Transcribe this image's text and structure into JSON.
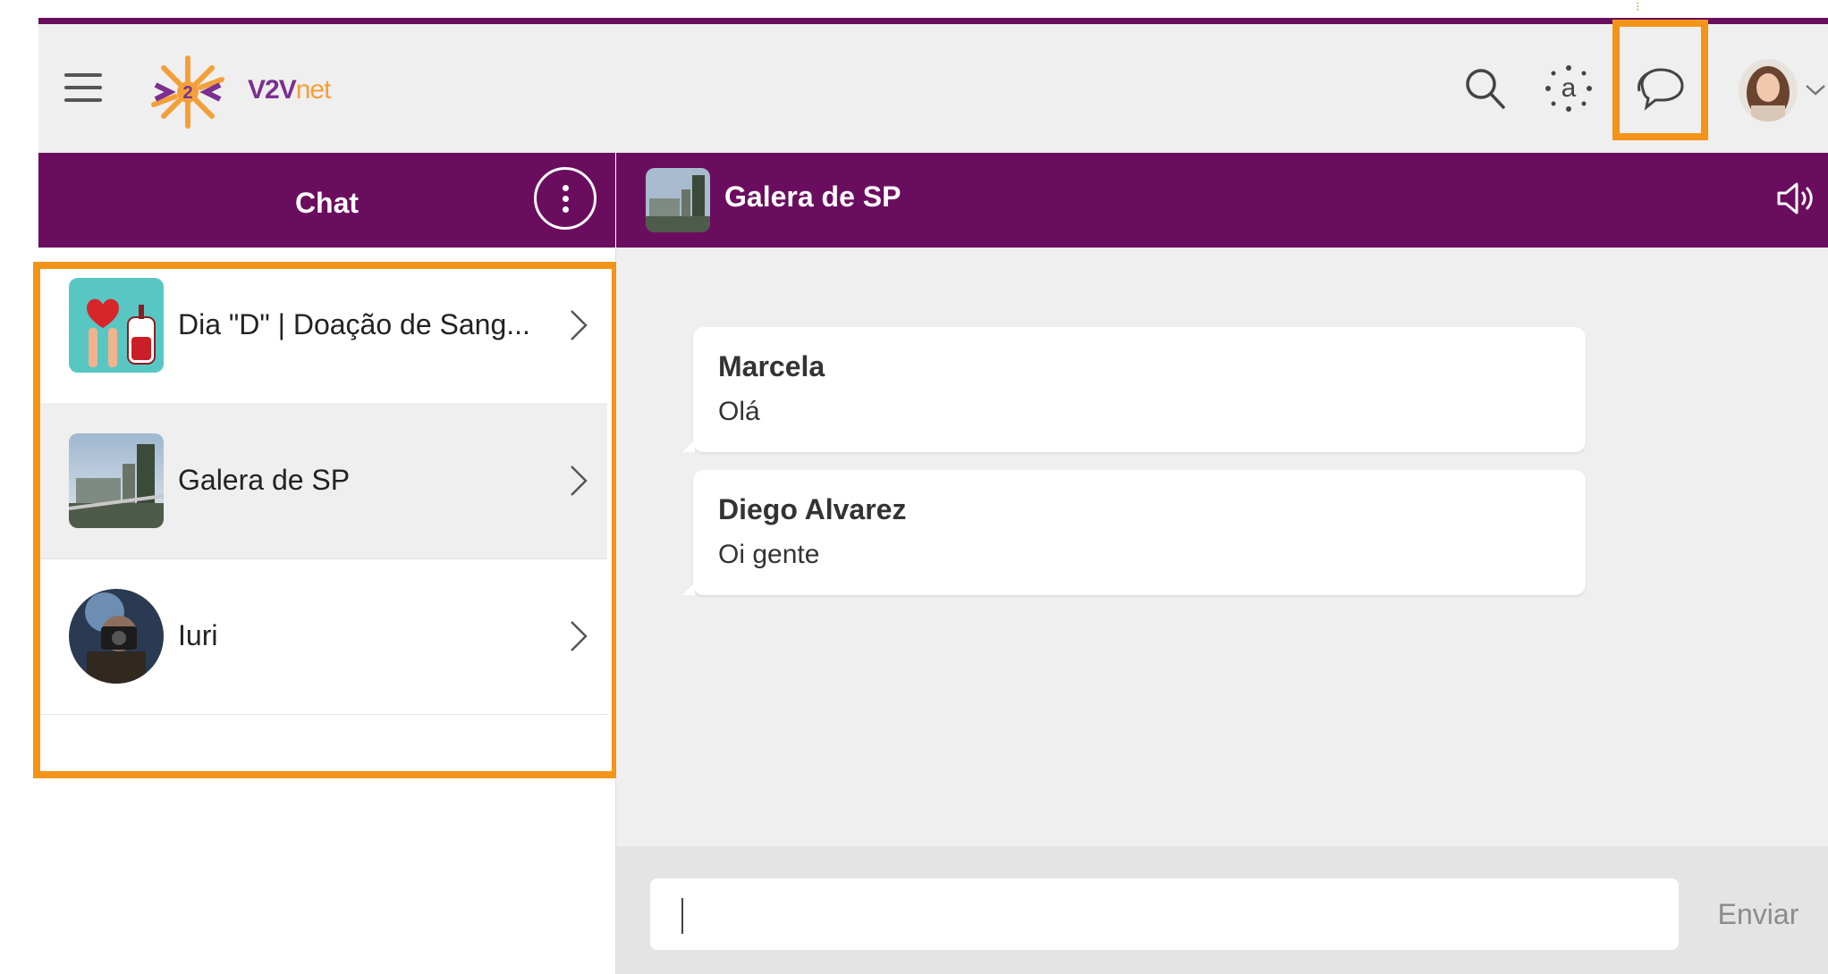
{
  "app": {
    "logo_text_main": "V2V",
    "logo_text_suffix": "net",
    "logo_mark": "2"
  },
  "header": {
    "icons": [
      "menu-icon",
      "search-icon",
      "accessibility-icon",
      "chat-icon",
      "profile-avatar",
      "chevron-down-icon"
    ]
  },
  "sidebar": {
    "title": "Chat",
    "more_icon": "more-vertical-icon",
    "conversations": [
      {
        "name": "Dia \"D\" | Doação de Sang...",
        "thumb": "blood-donation-image"
      },
      {
        "name": "Galera de SP",
        "thumb": "city-skyline-image"
      },
      {
        "name": "Iuri",
        "thumb": "person-avatar"
      }
    ]
  },
  "room": {
    "title": "Galera de SP",
    "sound_icon": "speaker-icon"
  },
  "messages": [
    {
      "author": "Marcela",
      "text": "Olá"
    },
    {
      "author": "Diego Alvarez",
      "text": "Oi gente"
    }
  ],
  "composer": {
    "placeholder": "",
    "send_label": "Enviar"
  },
  "colors": {
    "brand_purple": "#6a0d5f",
    "highlight_orange": "#f39419",
    "send_gray": "#8c8c8c"
  }
}
